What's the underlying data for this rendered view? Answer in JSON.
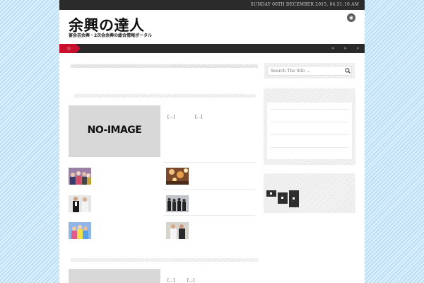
{
  "header": {
    "date": "SUNDAY 06TH DECEMBER 2015, 04:51:10 AM",
    "site_title": "余興の達人",
    "site_subtitle": "宴会芸余興・2次会余興の総合情報ポータル"
  },
  "nav": {
    "items": [
      "»",
      "»",
      "»"
    ]
  },
  "featured": [
    {
      "placeholder": "NO-IMAGE",
      "excerpts": [
        "[...]",
        "[...]"
      ]
    },
    {
      "excerpts": [
        "[...]",
        "[...]"
      ]
    }
  ],
  "search": {
    "placeholder": "Search The Site ..."
  },
  "colors": {
    "accent": "#c8102e",
    "bar": "#2a2a2a",
    "background": "#cfe7f7"
  },
  "icons": {
    "rss": "rss-icon",
    "home": "home-icon",
    "search": "search-icon"
  }
}
